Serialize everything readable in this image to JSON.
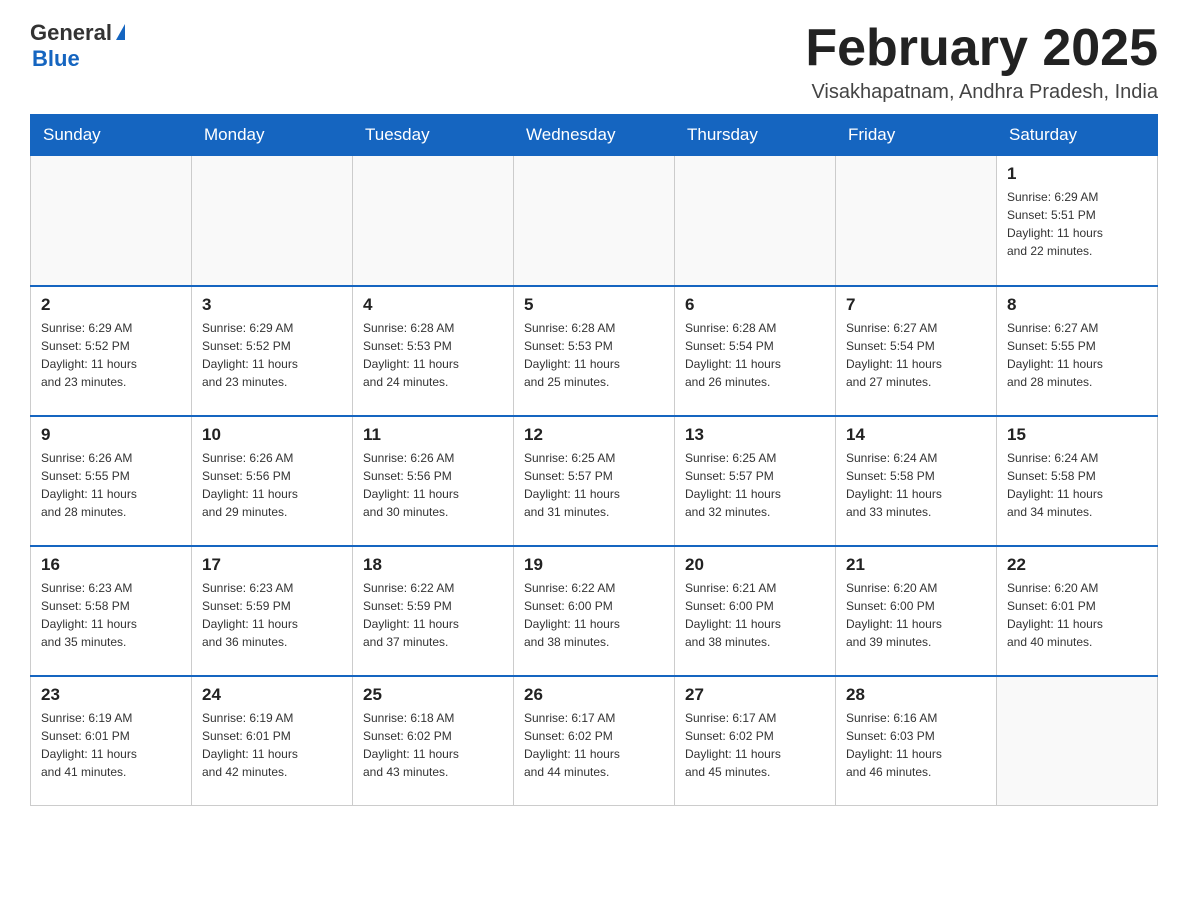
{
  "header": {
    "logo_general": "General",
    "logo_blue": "Blue",
    "month_title": "February 2025",
    "location": "Visakhapatnam, Andhra Pradesh, India"
  },
  "weekdays": [
    "Sunday",
    "Monday",
    "Tuesday",
    "Wednesday",
    "Thursday",
    "Friday",
    "Saturday"
  ],
  "weeks": [
    [
      {
        "day": "",
        "info": ""
      },
      {
        "day": "",
        "info": ""
      },
      {
        "day": "",
        "info": ""
      },
      {
        "day": "",
        "info": ""
      },
      {
        "day": "",
        "info": ""
      },
      {
        "day": "",
        "info": ""
      },
      {
        "day": "1",
        "info": "Sunrise: 6:29 AM\nSunset: 5:51 PM\nDaylight: 11 hours\nand 22 minutes."
      }
    ],
    [
      {
        "day": "2",
        "info": "Sunrise: 6:29 AM\nSunset: 5:52 PM\nDaylight: 11 hours\nand 23 minutes."
      },
      {
        "day": "3",
        "info": "Sunrise: 6:29 AM\nSunset: 5:52 PM\nDaylight: 11 hours\nand 23 minutes."
      },
      {
        "day": "4",
        "info": "Sunrise: 6:28 AM\nSunset: 5:53 PM\nDaylight: 11 hours\nand 24 minutes."
      },
      {
        "day": "5",
        "info": "Sunrise: 6:28 AM\nSunset: 5:53 PM\nDaylight: 11 hours\nand 25 minutes."
      },
      {
        "day": "6",
        "info": "Sunrise: 6:28 AM\nSunset: 5:54 PM\nDaylight: 11 hours\nand 26 minutes."
      },
      {
        "day": "7",
        "info": "Sunrise: 6:27 AM\nSunset: 5:54 PM\nDaylight: 11 hours\nand 27 minutes."
      },
      {
        "day": "8",
        "info": "Sunrise: 6:27 AM\nSunset: 5:55 PM\nDaylight: 11 hours\nand 28 minutes."
      }
    ],
    [
      {
        "day": "9",
        "info": "Sunrise: 6:26 AM\nSunset: 5:55 PM\nDaylight: 11 hours\nand 28 minutes."
      },
      {
        "day": "10",
        "info": "Sunrise: 6:26 AM\nSunset: 5:56 PM\nDaylight: 11 hours\nand 29 minutes."
      },
      {
        "day": "11",
        "info": "Sunrise: 6:26 AM\nSunset: 5:56 PM\nDaylight: 11 hours\nand 30 minutes."
      },
      {
        "day": "12",
        "info": "Sunrise: 6:25 AM\nSunset: 5:57 PM\nDaylight: 11 hours\nand 31 minutes."
      },
      {
        "day": "13",
        "info": "Sunrise: 6:25 AM\nSunset: 5:57 PM\nDaylight: 11 hours\nand 32 minutes."
      },
      {
        "day": "14",
        "info": "Sunrise: 6:24 AM\nSunset: 5:58 PM\nDaylight: 11 hours\nand 33 minutes."
      },
      {
        "day": "15",
        "info": "Sunrise: 6:24 AM\nSunset: 5:58 PM\nDaylight: 11 hours\nand 34 minutes."
      }
    ],
    [
      {
        "day": "16",
        "info": "Sunrise: 6:23 AM\nSunset: 5:58 PM\nDaylight: 11 hours\nand 35 minutes."
      },
      {
        "day": "17",
        "info": "Sunrise: 6:23 AM\nSunset: 5:59 PM\nDaylight: 11 hours\nand 36 minutes."
      },
      {
        "day": "18",
        "info": "Sunrise: 6:22 AM\nSunset: 5:59 PM\nDaylight: 11 hours\nand 37 minutes."
      },
      {
        "day": "19",
        "info": "Sunrise: 6:22 AM\nSunset: 6:00 PM\nDaylight: 11 hours\nand 38 minutes."
      },
      {
        "day": "20",
        "info": "Sunrise: 6:21 AM\nSunset: 6:00 PM\nDaylight: 11 hours\nand 38 minutes."
      },
      {
        "day": "21",
        "info": "Sunrise: 6:20 AM\nSunset: 6:00 PM\nDaylight: 11 hours\nand 39 minutes."
      },
      {
        "day": "22",
        "info": "Sunrise: 6:20 AM\nSunset: 6:01 PM\nDaylight: 11 hours\nand 40 minutes."
      }
    ],
    [
      {
        "day": "23",
        "info": "Sunrise: 6:19 AM\nSunset: 6:01 PM\nDaylight: 11 hours\nand 41 minutes."
      },
      {
        "day": "24",
        "info": "Sunrise: 6:19 AM\nSunset: 6:01 PM\nDaylight: 11 hours\nand 42 minutes."
      },
      {
        "day": "25",
        "info": "Sunrise: 6:18 AM\nSunset: 6:02 PM\nDaylight: 11 hours\nand 43 minutes."
      },
      {
        "day": "26",
        "info": "Sunrise: 6:17 AM\nSunset: 6:02 PM\nDaylight: 11 hours\nand 44 minutes."
      },
      {
        "day": "27",
        "info": "Sunrise: 6:17 AM\nSunset: 6:02 PM\nDaylight: 11 hours\nand 45 minutes."
      },
      {
        "day": "28",
        "info": "Sunrise: 6:16 AM\nSunset: 6:03 PM\nDaylight: 11 hours\nand 46 minutes."
      },
      {
        "day": "",
        "info": ""
      }
    ]
  ]
}
